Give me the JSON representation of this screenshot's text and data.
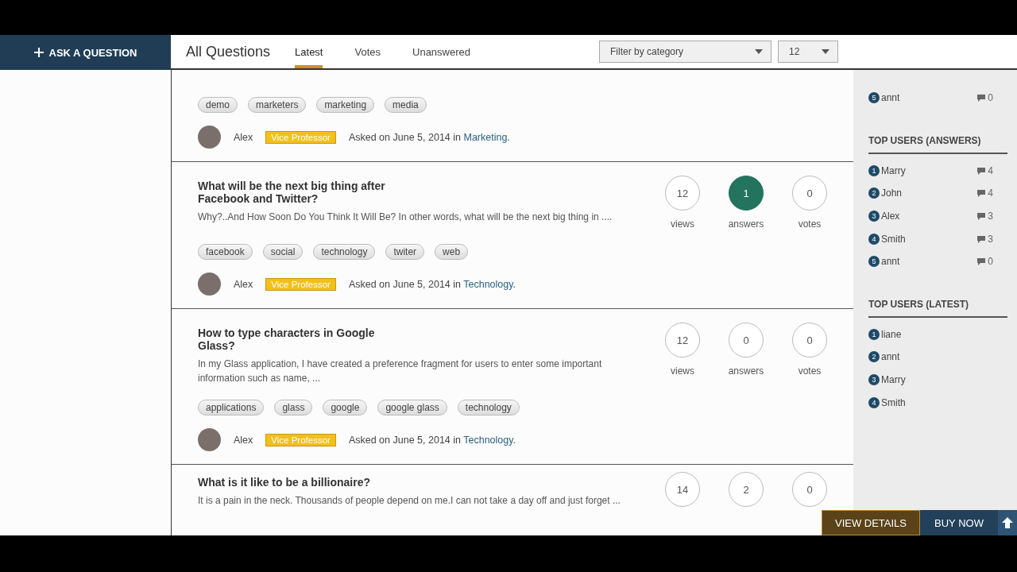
{
  "ask_button": "ASK A QUESTION",
  "header": {
    "title": "All Questions",
    "tabs": [
      {
        "label": "Latest",
        "selected": true
      },
      {
        "label": "Votes",
        "selected": false
      },
      {
        "label": "Unanswered",
        "selected": false
      }
    ],
    "filters": [
      {
        "kind": "wide",
        "value": "Filter by category"
      },
      {
        "kind": "narrow",
        "value": "12"
      }
    ]
  },
  "questions": [
    {
      "tags": [
        "demo",
        "marketers",
        "marketing",
        "media"
      ],
      "author": "Alex",
      "badge": "Vice Professor",
      "asked": "Asked on June 5, 2014 in",
      "category": "Marketing",
      "end": "."
    },
    {
      "title": "What will be the next big thing after Facebook and Twitter?",
      "excerpt": "Why?..And How Soon Do You Think It Will Be? In other words, what will be the next big thing in ....",
      "stats": [
        {
          "value": "12",
          "label": "views",
          "highlighted": false
        },
        {
          "value": "1",
          "label": "answers",
          "highlighted": true
        },
        {
          "value": "0",
          "label": "votes",
          "highlighted": false
        }
      ],
      "tags": [
        "facebook",
        "social",
        "technology",
        "twiter",
        "web"
      ],
      "author": "Alex",
      "badge": "Vice Professor",
      "asked": "Asked on June 5, 2014 in",
      "category": "Technology",
      "end": "."
    },
    {
      "title": "How to type characters in Google Glass?",
      "excerpt": "In my Glass application, I have created a preference fragment for users to enter some important information such as name, ...",
      "stats": [
        {
          "value": "12",
          "label": "views",
          "highlighted": false
        },
        {
          "value": "0",
          "label": "answers",
          "highlighted": false
        },
        {
          "value": "0",
          "label": "votes",
          "highlighted": false
        }
      ],
      "tags": [
        "applications",
        "glass",
        "google",
        "google glass",
        "technology"
      ],
      "author": "Alex",
      "badge": "Vice Professor",
      "asked": "Asked on June 5, 2014 in",
      "category": "Technology",
      "end": "."
    },
    {
      "title": "What is it like to be a billionaire?",
      "excerpt": "It is a pain in the neck. Thousands of people depend on me.I can not take a day off and just forget ...",
      "stats": [
        {
          "value": "14",
          "highlighted": false
        },
        {
          "value": "2",
          "highlighted": false
        },
        {
          "value": "0",
          "highlighted": false
        }
      ]
    }
  ],
  "sidebar": [
    {
      "users": [
        {
          "rank": "5",
          "name": "annt",
          "count": "0"
        }
      ]
    },
    {
      "heading": "TOP USERS (ANSWERS)",
      "users": [
        {
          "rank": "1",
          "name": "Marry",
          "count": "4"
        },
        {
          "rank": "2",
          "name": "John",
          "count": "4"
        },
        {
          "rank": "3",
          "name": "Alex",
          "count": "3"
        },
        {
          "rank": "4",
          "name": "Smith",
          "count": "3"
        },
        {
          "rank": "5",
          "name": "annt",
          "count": "0"
        }
      ]
    },
    {
      "heading": "TOP USERS (LATEST)",
      "users": [
        {
          "rank": "1",
          "name": "liane"
        },
        {
          "rank": "2",
          "name": "annt"
        },
        {
          "rank": "3",
          "name": "Marry"
        },
        {
          "rank": "4",
          "name": "Smith"
        }
      ]
    }
  ],
  "promo": {
    "details": "VIEW DETAILS",
    "buy": "BUY NOW"
  }
}
